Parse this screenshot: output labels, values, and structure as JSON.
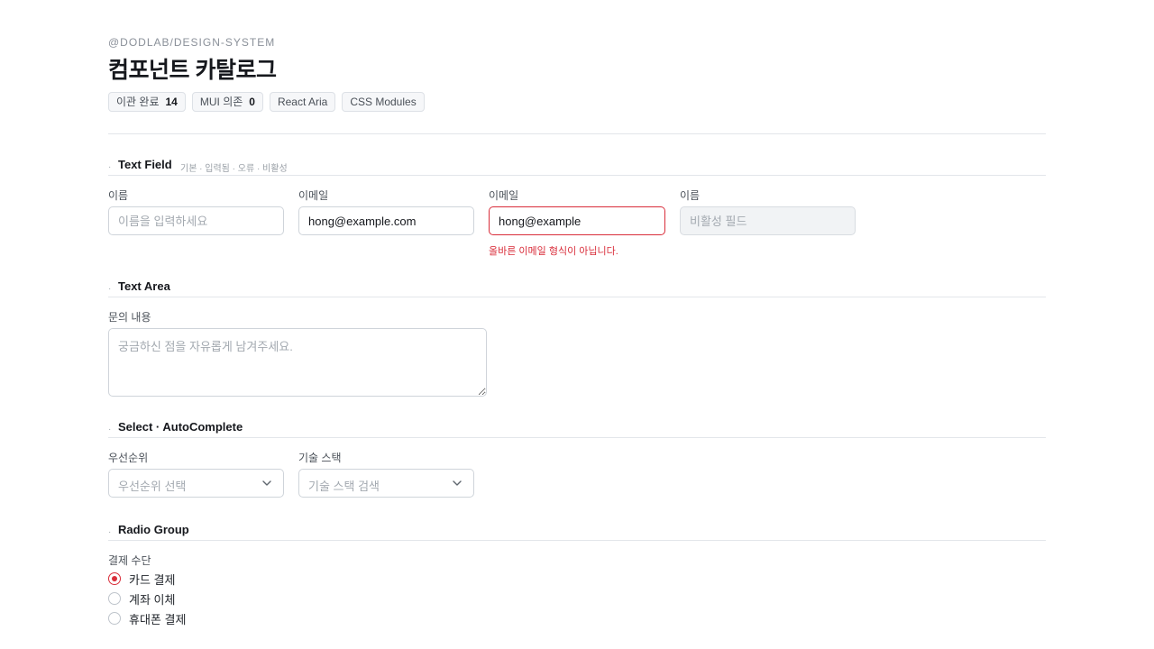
{
  "header": {
    "eyebrow": "@DODLAB/DESIGN-SYSTEM",
    "title": "컴포넌트 카탈로그",
    "chips": [
      {
        "label": "이관 완료",
        "count": "14"
      },
      {
        "label": "MUI 의존",
        "count": "0"
      },
      {
        "label": "React Aria",
        "count": ""
      },
      {
        "label": "CSS Modules",
        "count": ""
      }
    ]
  },
  "sections": {
    "text_field": {
      "dot": "·",
      "title": "Text Field",
      "desc": "기본 · 입력됨 · 오류 · 비활성",
      "fields": [
        {
          "label": "이름",
          "value": "",
          "placeholder": "이름을 입력하세요"
        },
        {
          "label": "이메일",
          "value": "hong@example.com",
          "placeholder": ""
        },
        {
          "label": "이메일",
          "value": "hong@example",
          "placeholder": "",
          "error": "올바른 이메일 형식이 아닙니다."
        },
        {
          "label": "이름",
          "value": "",
          "placeholder": "비활성 필드"
        }
      ]
    },
    "text_area": {
      "dot": "·",
      "title": "Text Area",
      "label": "문의 내용",
      "placeholder": "궁금하신 점을 자유롭게 남겨주세요."
    },
    "select": {
      "dot": "·",
      "title": "Select · AutoComplete",
      "items": [
        {
          "label": "우선순위",
          "placeholder": "우선순위 선택"
        },
        {
          "label": "기술 스택",
          "placeholder": "기술 스택 검색"
        }
      ]
    },
    "radio": {
      "dot": "·",
      "title": "Radio Group",
      "label": "결제 수단",
      "options": [
        {
          "label": "카드 결제",
          "selected": true
        },
        {
          "label": "계좌 이체",
          "selected": false
        },
        {
          "label": "휴대폰 결제",
          "selected": false
        }
      ]
    }
  },
  "colors": {
    "accent": "#d92d3a",
    "border": "#cfd4da",
    "muted": "#a3a9b0"
  },
  "icons": {
    "select_chevron": "chevron-down-icon"
  }
}
